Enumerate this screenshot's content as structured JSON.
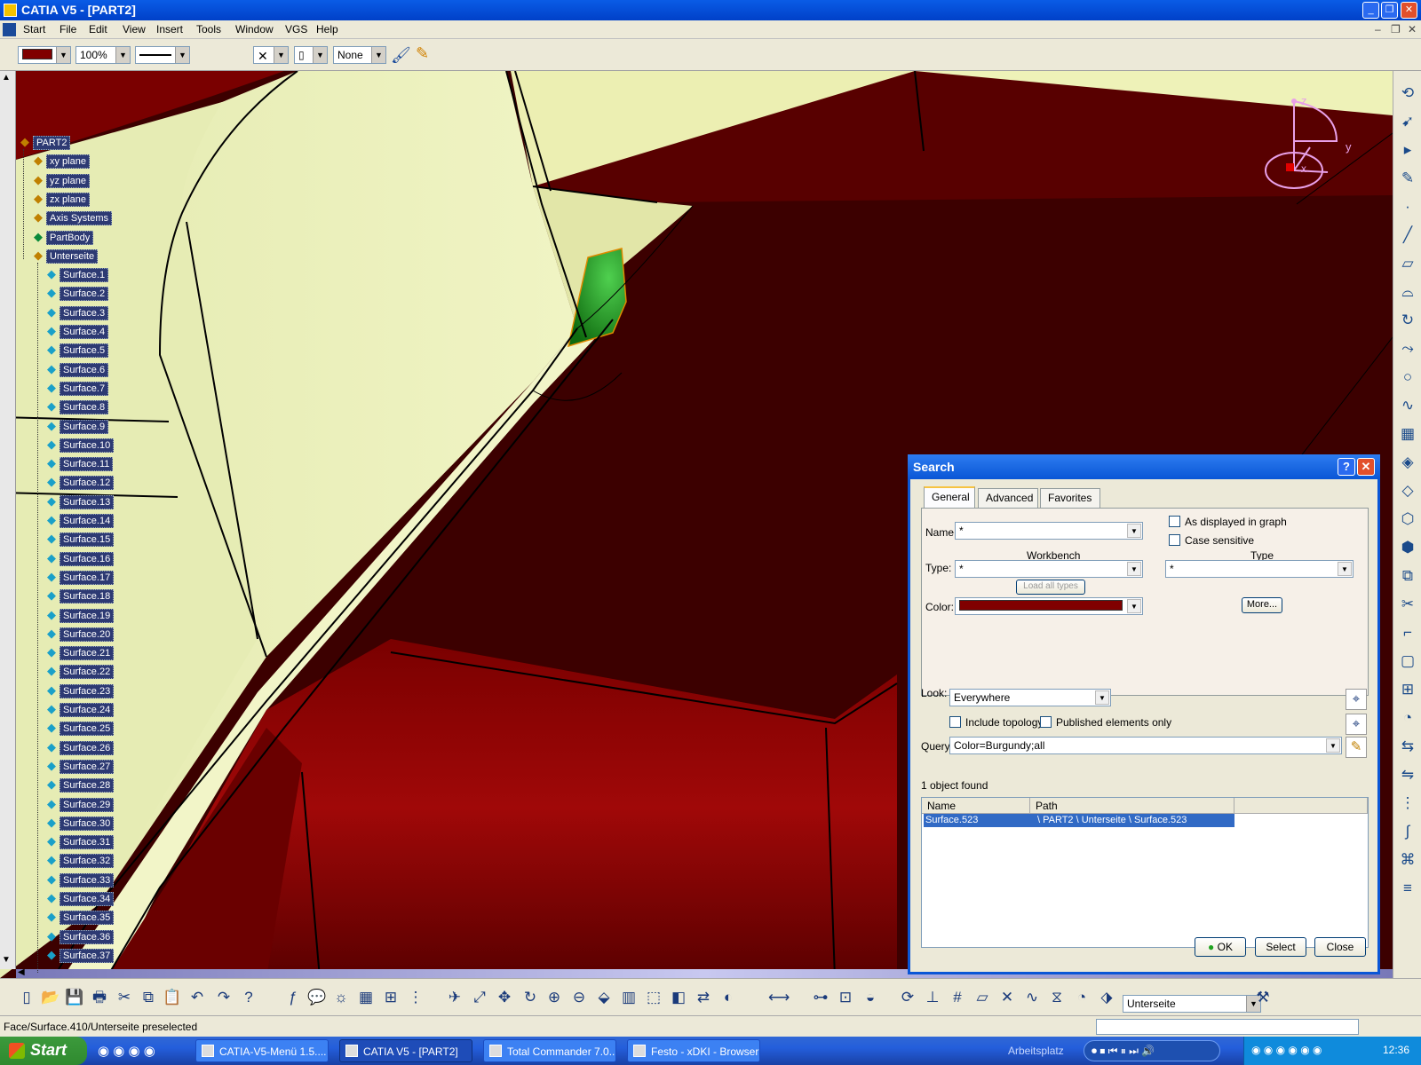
{
  "window": {
    "title": "CATIA V5 - [PART2]"
  },
  "menu": [
    "Start",
    "File",
    "Edit",
    "View",
    "Insert",
    "Tools",
    "Window",
    "VGS",
    "Help"
  ],
  "toolbar_top": {
    "color_value": "#800000",
    "zoom_value": "100%",
    "linetype_value": "None"
  },
  "tree": {
    "root": "PART2",
    "items": [
      "xy plane",
      "yz plane",
      "zx plane",
      "Axis Systems",
      "PartBody",
      "Unterseite"
    ],
    "surfaces": [
      "Surface.1",
      "Surface.2",
      "Surface.3",
      "Surface.4",
      "Surface.5",
      "Surface.6",
      "Surface.7",
      "Surface.8",
      "Surface.9",
      "Surface.10",
      "Surface.11",
      "Surface.12",
      "Surface.13",
      "Surface.14",
      "Surface.15",
      "Surface.16",
      "Surface.17",
      "Surface.18",
      "Surface.19",
      "Surface.20",
      "Surface.21",
      "Surface.22",
      "Surface.23",
      "Surface.24",
      "Surface.25",
      "Surface.26",
      "Surface.27",
      "Surface.28",
      "Surface.29",
      "Surface.30",
      "Surface.31",
      "Surface.32",
      "Surface.33",
      "Surface.34",
      "Surface.35",
      "Surface.36",
      "Surface.37"
    ]
  },
  "compass": {
    "z": "z",
    "y": "y",
    "x": "x"
  },
  "search": {
    "title": "Search",
    "tabs": [
      "General",
      "Advanced",
      "Favorites"
    ],
    "name_label": "Name:",
    "name_value": "*",
    "workbench_label": "Workbench",
    "type_label": "Type:",
    "type_value": "*",
    "type_col_label": "Type",
    "type2_value": "*",
    "load_types": "Load all types",
    "color_label": "Color:",
    "color_value": "#800000",
    "more": "More...",
    "as_displayed": "As displayed in graph",
    "case_sensitive": "Case sensitive",
    "look_label": "Look:",
    "look_value": "Everywhere",
    "include_topology": "Include topology",
    "published_only": "Published elements only",
    "query_label": "Query:",
    "query_value": "Color=Burgundy;all",
    "found": "1 object found",
    "col_name": "Name",
    "col_path": "Path",
    "result_name": "Surface.523",
    "result_path": "\\ PART2 \\ Unterseite \\ Surface.523",
    "ok": "OK",
    "select": "Select",
    "close": "Close"
  },
  "bottom_toolbar": {
    "active_set": "Unterseite"
  },
  "status": "Face/Surface.410/Unterseite preselected",
  "taskbar": {
    "start": "Start",
    "tasks": [
      "CATIA-V5-Menü 1.5....",
      "CATIA V5 - [PART2]",
      "Total Commander 7.0...",
      "Festo - xDKI - Browser"
    ],
    "arbeitsplatz": "Arbeitsplatz",
    "clock": "12:36"
  },
  "colors": {
    "burgundy": "#800000",
    "surface": "#eef2b8",
    "selected": "#1f9a1f",
    "accent": "#0a56d6"
  }
}
